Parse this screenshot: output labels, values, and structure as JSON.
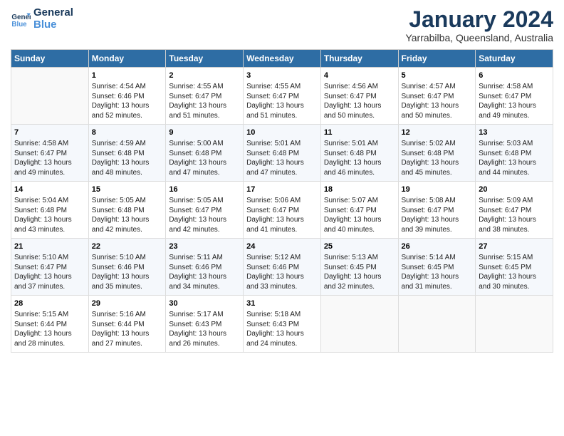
{
  "logo": {
    "line1": "General",
    "line2": "Blue"
  },
  "title": "January 2024",
  "subtitle": "Yarrabilba, Queensland, Australia",
  "weekdays": [
    "Sunday",
    "Monday",
    "Tuesday",
    "Wednesday",
    "Thursday",
    "Friday",
    "Saturday"
  ],
  "weeks": [
    [
      {
        "day": "",
        "info": ""
      },
      {
        "day": "1",
        "info": "Sunrise: 4:54 AM\nSunset: 6:46 PM\nDaylight: 13 hours\nand 52 minutes."
      },
      {
        "day": "2",
        "info": "Sunrise: 4:55 AM\nSunset: 6:47 PM\nDaylight: 13 hours\nand 51 minutes."
      },
      {
        "day": "3",
        "info": "Sunrise: 4:55 AM\nSunset: 6:47 PM\nDaylight: 13 hours\nand 51 minutes."
      },
      {
        "day": "4",
        "info": "Sunrise: 4:56 AM\nSunset: 6:47 PM\nDaylight: 13 hours\nand 50 minutes."
      },
      {
        "day": "5",
        "info": "Sunrise: 4:57 AM\nSunset: 6:47 PM\nDaylight: 13 hours\nand 50 minutes."
      },
      {
        "day": "6",
        "info": "Sunrise: 4:58 AM\nSunset: 6:47 PM\nDaylight: 13 hours\nand 49 minutes."
      }
    ],
    [
      {
        "day": "7",
        "info": "Sunrise: 4:58 AM\nSunset: 6:47 PM\nDaylight: 13 hours\nand 49 minutes."
      },
      {
        "day": "8",
        "info": "Sunrise: 4:59 AM\nSunset: 6:48 PM\nDaylight: 13 hours\nand 48 minutes."
      },
      {
        "day": "9",
        "info": "Sunrise: 5:00 AM\nSunset: 6:48 PM\nDaylight: 13 hours\nand 47 minutes."
      },
      {
        "day": "10",
        "info": "Sunrise: 5:01 AM\nSunset: 6:48 PM\nDaylight: 13 hours\nand 47 minutes."
      },
      {
        "day": "11",
        "info": "Sunrise: 5:01 AM\nSunset: 6:48 PM\nDaylight: 13 hours\nand 46 minutes."
      },
      {
        "day": "12",
        "info": "Sunrise: 5:02 AM\nSunset: 6:48 PM\nDaylight: 13 hours\nand 45 minutes."
      },
      {
        "day": "13",
        "info": "Sunrise: 5:03 AM\nSunset: 6:48 PM\nDaylight: 13 hours\nand 44 minutes."
      }
    ],
    [
      {
        "day": "14",
        "info": "Sunrise: 5:04 AM\nSunset: 6:48 PM\nDaylight: 13 hours\nand 43 minutes."
      },
      {
        "day": "15",
        "info": "Sunrise: 5:05 AM\nSunset: 6:48 PM\nDaylight: 13 hours\nand 42 minutes."
      },
      {
        "day": "16",
        "info": "Sunrise: 5:05 AM\nSunset: 6:47 PM\nDaylight: 13 hours\nand 42 minutes."
      },
      {
        "day": "17",
        "info": "Sunrise: 5:06 AM\nSunset: 6:47 PM\nDaylight: 13 hours\nand 41 minutes."
      },
      {
        "day": "18",
        "info": "Sunrise: 5:07 AM\nSunset: 6:47 PM\nDaylight: 13 hours\nand 40 minutes."
      },
      {
        "day": "19",
        "info": "Sunrise: 5:08 AM\nSunset: 6:47 PM\nDaylight: 13 hours\nand 39 minutes."
      },
      {
        "day": "20",
        "info": "Sunrise: 5:09 AM\nSunset: 6:47 PM\nDaylight: 13 hours\nand 38 minutes."
      }
    ],
    [
      {
        "day": "21",
        "info": "Sunrise: 5:10 AM\nSunset: 6:47 PM\nDaylight: 13 hours\nand 37 minutes."
      },
      {
        "day": "22",
        "info": "Sunrise: 5:10 AM\nSunset: 6:46 PM\nDaylight: 13 hours\nand 35 minutes."
      },
      {
        "day": "23",
        "info": "Sunrise: 5:11 AM\nSunset: 6:46 PM\nDaylight: 13 hours\nand 34 minutes."
      },
      {
        "day": "24",
        "info": "Sunrise: 5:12 AM\nSunset: 6:46 PM\nDaylight: 13 hours\nand 33 minutes."
      },
      {
        "day": "25",
        "info": "Sunrise: 5:13 AM\nSunset: 6:45 PM\nDaylight: 13 hours\nand 32 minutes."
      },
      {
        "day": "26",
        "info": "Sunrise: 5:14 AM\nSunset: 6:45 PM\nDaylight: 13 hours\nand 31 minutes."
      },
      {
        "day": "27",
        "info": "Sunrise: 5:15 AM\nSunset: 6:45 PM\nDaylight: 13 hours\nand 30 minutes."
      }
    ],
    [
      {
        "day": "28",
        "info": "Sunrise: 5:15 AM\nSunset: 6:44 PM\nDaylight: 13 hours\nand 28 minutes."
      },
      {
        "day": "29",
        "info": "Sunrise: 5:16 AM\nSunset: 6:44 PM\nDaylight: 13 hours\nand 27 minutes."
      },
      {
        "day": "30",
        "info": "Sunrise: 5:17 AM\nSunset: 6:43 PM\nDaylight: 13 hours\nand 26 minutes."
      },
      {
        "day": "31",
        "info": "Sunrise: 5:18 AM\nSunset: 6:43 PM\nDaylight: 13 hours\nand 24 minutes."
      },
      {
        "day": "",
        "info": ""
      },
      {
        "day": "",
        "info": ""
      },
      {
        "day": "",
        "info": ""
      }
    ]
  ]
}
